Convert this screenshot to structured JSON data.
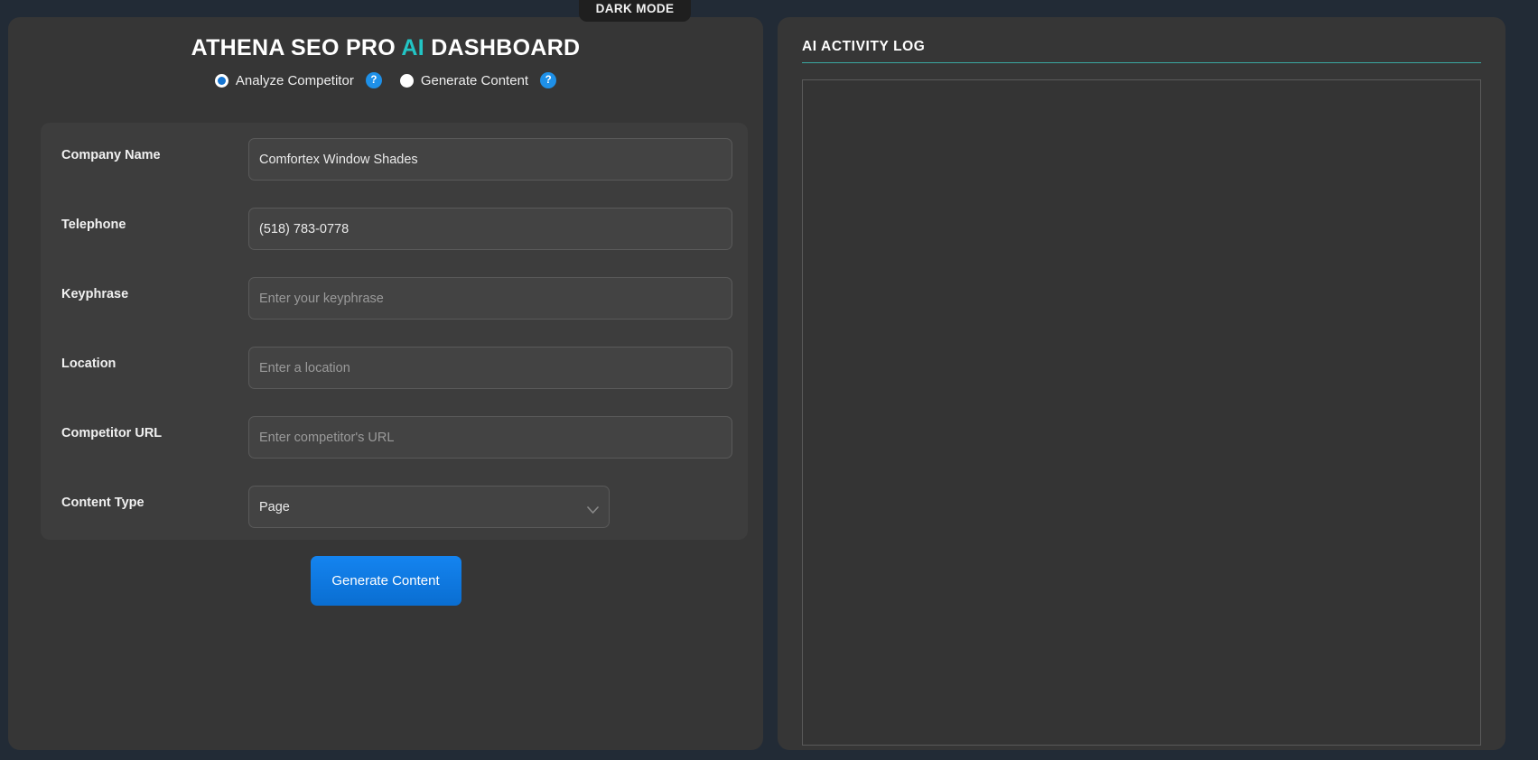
{
  "topbar": {
    "dark_mode_label": "DARK MODE"
  },
  "left_panel": {
    "title_prefix": "ATHENA SEO PRO ",
    "title_accent": "AI",
    "title_suffix": " DASHBOARD",
    "accent_color": "#22c4c4",
    "modes": [
      {
        "label": "Analyze Competitor",
        "selected": true,
        "help": "?"
      },
      {
        "label": "Generate Content",
        "selected": false,
        "help": "?"
      }
    ],
    "form": {
      "fields": [
        {
          "label": "Company Name",
          "type": "text",
          "value": "Comfortex Window Shades",
          "placeholder": ""
        },
        {
          "label": "Telephone",
          "type": "text",
          "value": "(518) 783-0778",
          "placeholder": ""
        },
        {
          "label": "Keyphrase",
          "type": "text",
          "value": "",
          "placeholder": "Enter your keyphrase"
        },
        {
          "label": "Location",
          "type": "text",
          "value": "",
          "placeholder": "Enter a location"
        },
        {
          "label": "Competitor URL",
          "type": "text",
          "value": "",
          "placeholder": "Enter competitor's URL"
        },
        {
          "label": "Content Type",
          "type": "select",
          "value": "Page",
          "placeholder": "",
          "options": [
            "Page"
          ],
          "icon": "chevron-down-icon"
        }
      ]
    },
    "submit_label": "Generate Content",
    "submit_color": "#0f78e0"
  },
  "right_panel": {
    "title": "AI ACTIVITY LOG",
    "underline_color": "#3aa9a2",
    "log_content": ""
  }
}
